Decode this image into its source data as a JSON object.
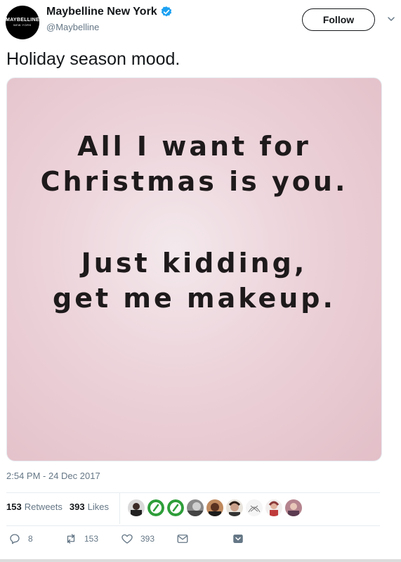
{
  "author": {
    "name": "Maybelline New York",
    "handle": "@Maybelline",
    "avatar_text": "MAYBELLINE",
    "avatar_subtext": "NEW YORK",
    "verified_color": "#1da1f2"
  },
  "follow_label": "Follow",
  "tweet_text": "Holiday season mood.",
  "image_text": {
    "line1": "All I want for",
    "line2": "Christmas is you.",
    "line3": "Just kidding,",
    "line4": "get me makeup."
  },
  "timestamp": "2:54 PM - 24 Dec 2017",
  "stats": {
    "retweets_count": "153",
    "retweets_label": "Retweets",
    "likes_count": "393",
    "likes_label": "Likes"
  },
  "actions": {
    "reply_count": "8",
    "retweet_count": "153",
    "like_count": "393"
  },
  "colors": {
    "text": "#14171a",
    "muted": "#657786",
    "border": "#e6ecf0",
    "image_bg": "#ecd2d9"
  }
}
